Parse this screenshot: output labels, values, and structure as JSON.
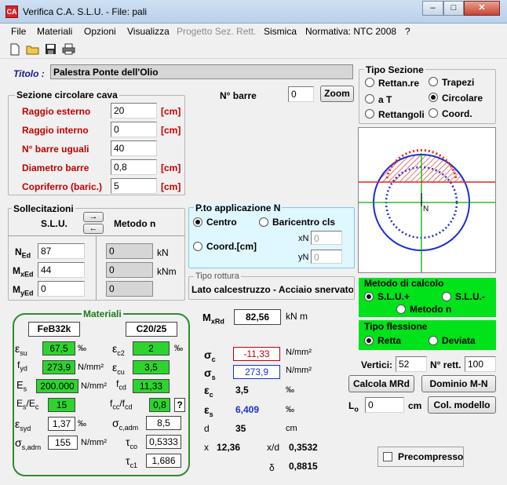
{
  "window": {
    "title": "Verifica C.A. S.L.U. - File: pali",
    "min": "–",
    "max": "□",
    "close": "✕"
  },
  "menu": [
    "File",
    "Materiali",
    "Opzioni",
    "Visualizza",
    "Progetto Sez. Rett.",
    "Sismica",
    "Normativa: NTC 2008",
    "?"
  ],
  "titolo": {
    "label": "Titolo :",
    "value": "Palestra Ponte dell'Olio"
  },
  "sezione": {
    "title": "Sezione circolare cava",
    "fields": [
      {
        "label": "Raggio esterno",
        "value": "20",
        "unit": "[cm]"
      },
      {
        "label": "Raggio interno",
        "value": "0",
        "unit": "[cm]"
      },
      {
        "label": "N° barre uguali",
        "value": "40",
        "unit": ""
      },
      {
        "label": "Diametro barre",
        "value": "0,8",
        "unit": "[cm]"
      },
      {
        "label": "Copriferro (baric.)",
        "value": "5",
        "unit": "[cm]"
      }
    ]
  },
  "nbarre": {
    "label": "N° barre",
    "value": "0",
    "zoom": "Zoom"
  },
  "tipo_sezione": {
    "title": "Tipo Sezione",
    "options": [
      "Rettan.re",
      "Trapezi",
      "a T",
      "Circolare",
      "Rettangoli",
      "Coord."
    ],
    "selected": "Circolare"
  },
  "sollecitazioni": {
    "title": "Sollecitazioni",
    "slu": "S.L.U.",
    "metodo": "Metodo n",
    "arrow_right": "→",
    "arrow_left": "←",
    "NEd": "87",
    "MxEd": "44",
    "MyEd": "0",
    "n1": "0",
    "n2": "0",
    "n3": "0",
    "unit_kN": "kN",
    "unit_kNm": "kNm"
  },
  "applicazione": {
    "title": "P.to applicazione N",
    "centro": "Centro",
    "baricentro": "Baricentro cls",
    "coord": "Coord.[cm]",
    "xN": "0",
    "yN": "0",
    "xN_label": "xN",
    "yN_label": "yN"
  },
  "rottura": {
    "title": "Tipo rottura",
    "value": "Lato calcestruzzo - Acciaio snervato"
  },
  "metodo_calcolo": {
    "title": "Metodo di calcolo",
    "options": [
      "S.L.U.+",
      "S.L.U.-",
      "Metodo n"
    ],
    "selected": "S.L.U.+"
  },
  "tipo_flessione": {
    "title": "Tipo flessione",
    "options": [
      "Retta",
      "Deviata"
    ],
    "selected": "Retta"
  },
  "vertici": {
    "label": "Vertici:",
    "value": "52",
    "nrett_label": "N° rett.",
    "nrett": "100"
  },
  "buttons": {
    "calcola": "Calcola MRd",
    "dominio": "Dominio M-N",
    "col_modello": "Col. modello"
  },
  "lo": {
    "label": "Lo",
    "value": "0",
    "unit": "cm"
  },
  "precompresso": "Precompresso",
  "materiali": {
    "title": "Materiali",
    "acciaio": "FeB32k",
    "cls": "C20/25",
    "esu": "67,5",
    "ec2": "2",
    "fyd": "273,9",
    "ecu": "3,5",
    "Es": "200.000",
    "fcd": "11,33",
    "EsEc": "15",
    "fccfcd": "0,8",
    "esyd": "1,37",
    "sigma_cadm": "8,5",
    "sigma_sadm": "155",
    "tau_co": "0,5333",
    "tau_c1": "1,686",
    "permille": "‰",
    "Nmm2": "N/mm²",
    "q": "?"
  },
  "risultati": {
    "MxRd": "82,56",
    "MxRd_unit": "kN m",
    "sigma_c": "-11,33",
    "sigma_s": "273,9",
    "eps_c": "3,5",
    "eps_s": "6,409",
    "d": "35",
    "x": "12,36",
    "xd": "0,3532",
    "delta": "0,8815",
    "Nmm2": "N/mm²",
    "permille": "‰",
    "cm": "cm",
    "x_label": "x",
    "xd_label": "x/d",
    "d_label": "d"
  },
  "colors": {
    "section_hatch": "#e0261b",
    "section_blue": "#1a2fd1",
    "green_panel": "#00e21a",
    "axis_green": "#00b000"
  }
}
